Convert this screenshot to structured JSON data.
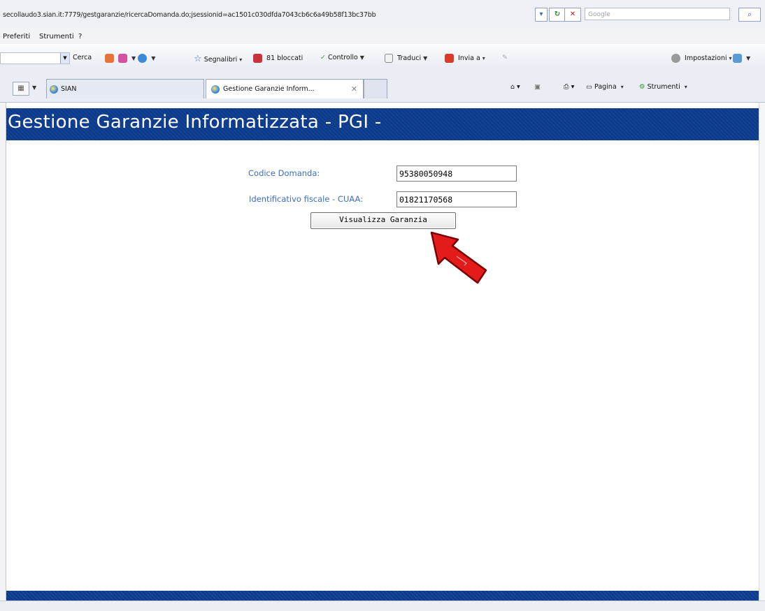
{
  "browser": {
    "url": "secollaudo3.sian.it:7779/gestgaranzie/ricercaDomanda.do;jsessionid=ac1501c030dfda7043cb6c6a49b58f13bc37bb",
    "search_placeholder": "Google",
    "menu": [
      "Preferiti",
      "Strumenti",
      "?"
    ],
    "toolbar": {
      "search_label": "Cerca",
      "bookmarks_label": "Segnalibri",
      "blocked_label": "81 bloccati",
      "check_label": "Controllo",
      "translate_label": "Traduci",
      "send_label": "Invia a",
      "settings_label": "Impostazioni"
    },
    "tabs": [
      {
        "label": "SIAN"
      },
      {
        "label": "Gestione Garanzie Inform..."
      }
    ],
    "commands": {
      "page_label": "Pagina",
      "tools_label": "Strumenti"
    }
  },
  "page": {
    "title": "Gestione Garanzie Informatizzata - PGI -",
    "form": {
      "codice_label": "Codice Domanda:",
      "codice_value": "95380050948",
      "cuaa_label": "Identificativo fiscale - CUAA:",
      "cuaa_value": "01821170568",
      "submit_label": "Visualizza Garanzia"
    },
    "colors": {
      "header_bg": "#0b3a8c",
      "label_color": "#3c6fbf",
      "arrow_color": "#e31b1b"
    }
  }
}
